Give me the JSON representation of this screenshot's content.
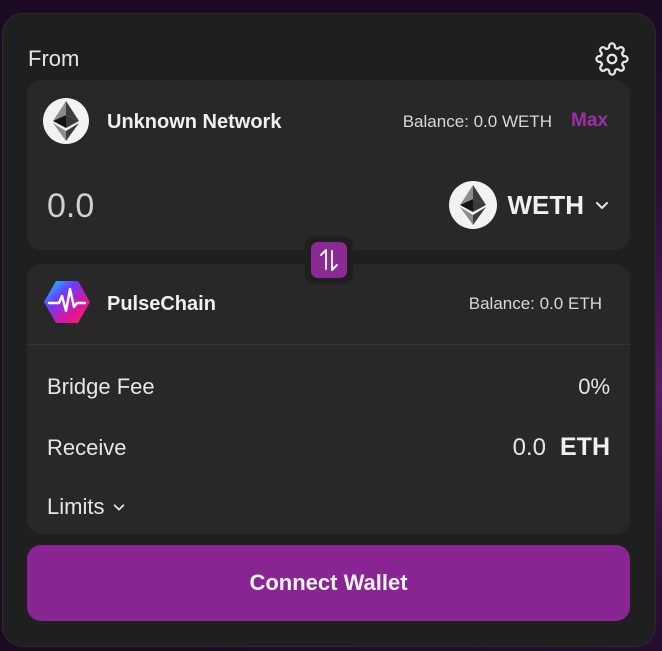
{
  "header": {
    "from_label": "From",
    "settings_icon": "gear-icon"
  },
  "source": {
    "network_name": "Unknown Network",
    "network_icon": "ethereum-icon",
    "balance": "Balance: 0.0 WETH",
    "max_label": "Max",
    "amount_value": "",
    "amount_placeholder": "0.0",
    "token": {
      "symbol": "WETH",
      "icon": "ethereum-icon"
    }
  },
  "swap_icon": "swap-arrows-icon",
  "destination": {
    "network_name": "PulseChain",
    "network_icon": "pulsechain-icon",
    "balance": "Balance: 0.0 ETH",
    "bridge_fee_label": "Bridge Fee",
    "bridge_fee_value": "0%",
    "receive_label": "Receive",
    "receive_amount": "0.0",
    "receive_symbol": "ETH",
    "limits_label": "Limits"
  },
  "connect_label": "Connect Wallet",
  "colors": {
    "accent": "#882593",
    "max_text": "#9c2fa6",
    "card_bg": "#1e1f1e",
    "panel_bg": "#272827"
  }
}
